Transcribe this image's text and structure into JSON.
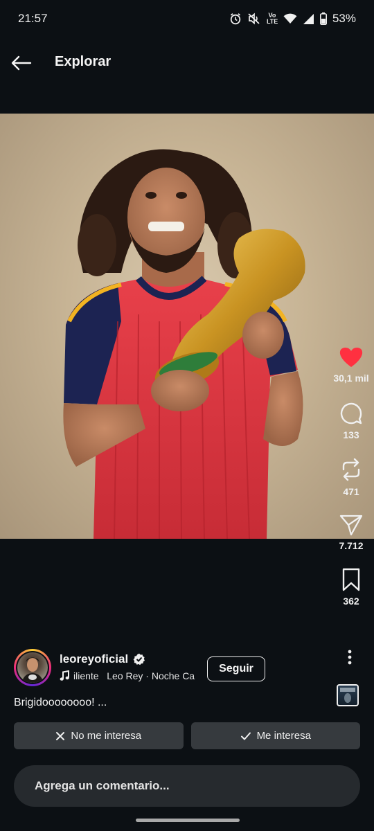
{
  "status_bar": {
    "time": "21:57",
    "battery": "53%",
    "icons": [
      "alarm-icon",
      "mute-icon",
      "volte-icon",
      "wifi-icon",
      "signal-icon",
      "battery-icon"
    ],
    "volte_label": "Vo LTE"
  },
  "header": {
    "title": "Explorar",
    "back_icon": "arrow-left-icon"
  },
  "post": {
    "image_alt": "Player in red jersey holding golden trophy",
    "caption": "Brigidoooooooo! ..."
  },
  "actions": {
    "like": {
      "icon": "heart-icon",
      "count": "30,1 mil",
      "liked": true
    },
    "comment": {
      "icon": "comment-icon",
      "count": "133"
    },
    "repost": {
      "icon": "repost-icon",
      "count": "471"
    },
    "share": {
      "icon": "send-icon",
      "count": "7.712"
    },
    "save": {
      "icon": "bookmark-icon",
      "count": "362"
    },
    "more_icon": "more-vertical-icon"
  },
  "author": {
    "username": "leoreyoficial",
    "verified": true,
    "music_icon": "music-note-icon",
    "music_text": "iliente   Leo Rey · Noche Ca",
    "follow_label": "Seguir"
  },
  "interest": {
    "not_interested_label": "No me interesa",
    "interested_label": "Me interesa"
  },
  "comment": {
    "placeholder": "Agrega un comentario..."
  },
  "colors": {
    "background": "#0c1014",
    "like": "#ff3040",
    "button_bg": "#363a3e",
    "input_bg": "#262a2e"
  }
}
